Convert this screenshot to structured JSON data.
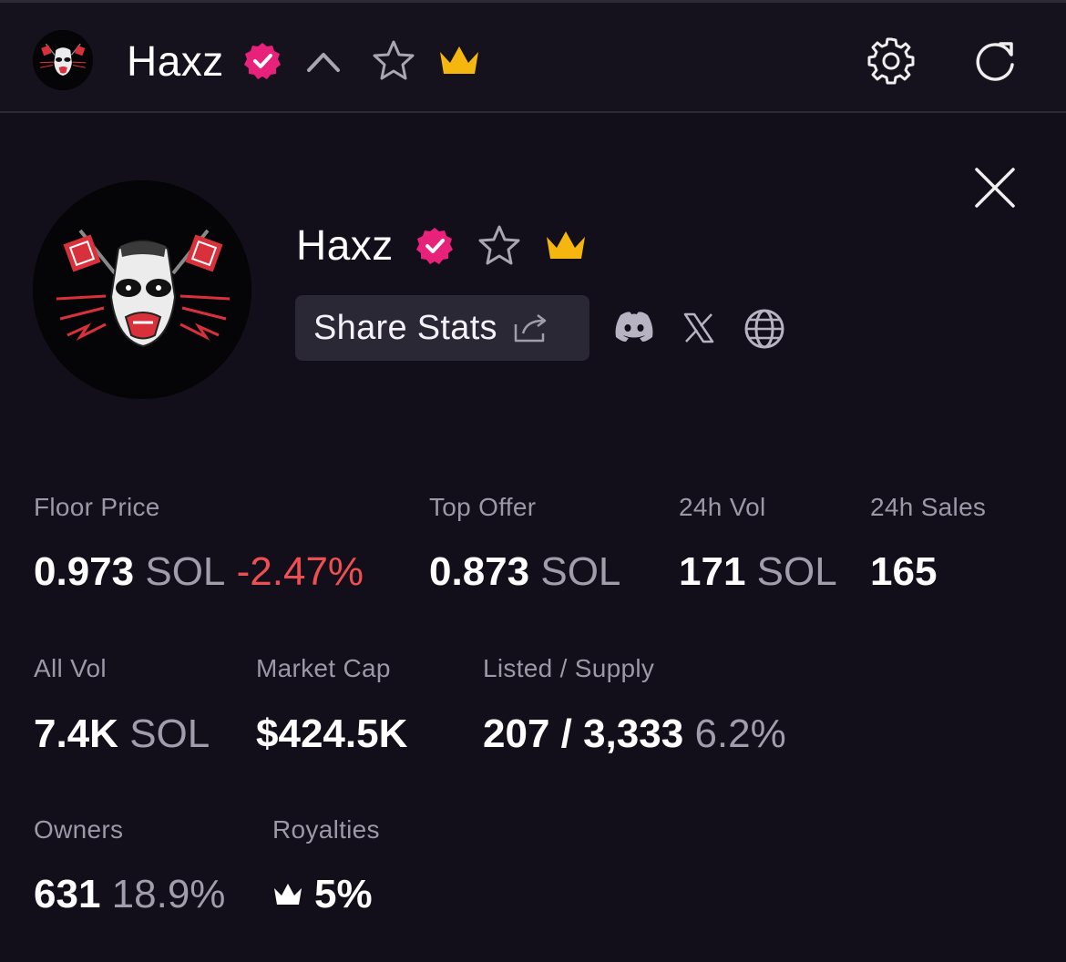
{
  "header": {
    "title": "Haxz",
    "icons": [
      "verified-badge-icon",
      "chevron-up-icon",
      "star-icon",
      "crown-icon",
      "settings-gear-icon",
      "refresh-icon"
    ]
  },
  "profile": {
    "name": "Haxz",
    "share_label": "Share Stats",
    "social_icons": [
      "discord-icon",
      "x-icon",
      "globe-icon"
    ]
  },
  "stats": {
    "floor_price": {
      "label": "Floor Price",
      "value": "0.973",
      "unit": "SOL",
      "change": "-2.47%"
    },
    "top_offer": {
      "label": "Top Offer",
      "value": "0.873",
      "unit": "SOL"
    },
    "vol_24h": {
      "label": "24h Vol",
      "value": "171",
      "unit": "SOL"
    },
    "sales_24h": {
      "label": "24h Sales",
      "value": "165"
    },
    "all_vol": {
      "label": "All Vol",
      "value": "7.4K",
      "unit": "SOL"
    },
    "market_cap": {
      "label": "Market Cap",
      "value": "$424.5K"
    },
    "listed_supply": {
      "label": "Listed / Supply",
      "value": "207 / 3,333",
      "pct": "6.2%"
    },
    "owners": {
      "label": "Owners",
      "value": "631",
      "pct": "18.9%"
    },
    "royalties": {
      "label": "Royalties",
      "value": "5%"
    }
  },
  "colors": {
    "background": "#120f1a",
    "verified": "#e8217a",
    "crown": "#f5b60f",
    "negative": "#ef4f52",
    "muted": "#9c98a8"
  }
}
